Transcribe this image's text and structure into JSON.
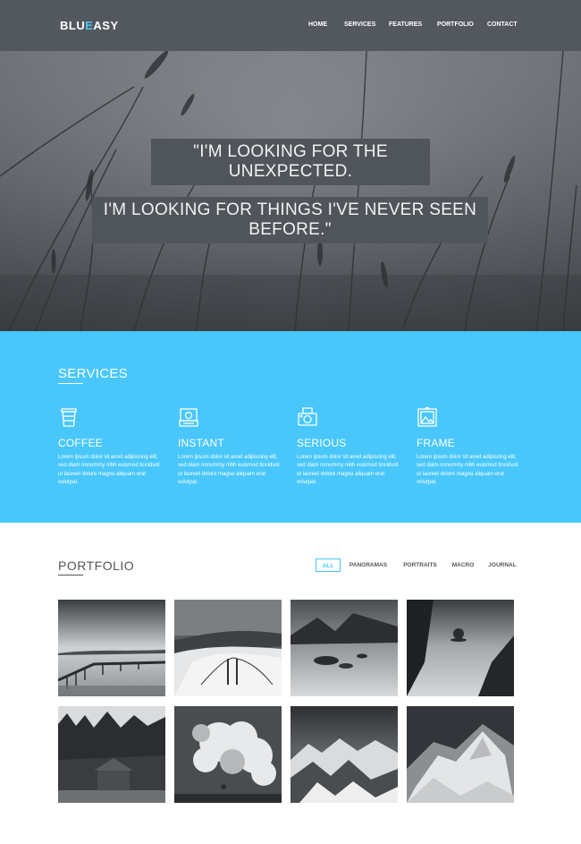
{
  "brand": {
    "prefix": "BLU",
    "accent": "E",
    "suffix": "ASY",
    "accent_color": "#4ec6f2"
  },
  "nav": {
    "items": [
      "HOME",
      "SERVICES",
      "FEATURES",
      "PORTFOLIO",
      "CONTACT"
    ]
  },
  "hero": {
    "quote_line1": "\"I'M LOOKING FOR THE",
    "quote_line2": "UNEXPECTED.",
    "quote_line3": "I'M LOOKING FOR THINGS I'VE NEVER SEEN",
    "quote_line4": "BEFORE.\""
  },
  "services": {
    "title": "SERVICES",
    "items": [
      {
        "title": "COFFEE",
        "icon": "coffee-cup-icon",
        "text": "Lorem ipsum dolor sit amet adipiscing elit, sed diam nonummy nibh euismod tincidunt ut laoreet dolore magna aliquam erat volutpat."
      },
      {
        "title": "INSTANT",
        "icon": "instant-camera-icon",
        "text": "Lorem ipsum dolor sit amet adipiscing elit, sed diam nonummy nibh euismod tincidunt ut laoreet dolore magna aliquam erat volutpat."
      },
      {
        "title": "SERIOUS",
        "icon": "camera-icon",
        "text": "Lorem ipsum dolor sit amet adipiscing elit, sed diam nonummy nibh euismod tincidunt ut laoreet dolore magna aliquam erat volutpat."
      },
      {
        "title": "FRAME",
        "icon": "picture-frame-icon",
        "text": "Lorem ipsum dolor sit amet adipiscing elit, sed diam nonummy nibh euismod tincidunt ut laoreet dolore magna aliquam erat volutpat."
      }
    ]
  },
  "portfolio": {
    "title": "PORTFOLIO",
    "filters": [
      "ALL",
      "PANORAMAS",
      "PORTRAITS",
      "MACRO",
      "JOURNAL"
    ],
    "active_filter": "ALL",
    "images": [
      "pier",
      "golden-gate-bridge",
      "rocks-in-sea",
      "lone-tree-island",
      "cabin-in-forest",
      "storm-clouds",
      "snowy-mountains",
      "snowy-peak"
    ]
  },
  "colors": {
    "header_bg": "#53585e",
    "services_bg": "#49c7fa",
    "quote_bg": "#50555b"
  }
}
